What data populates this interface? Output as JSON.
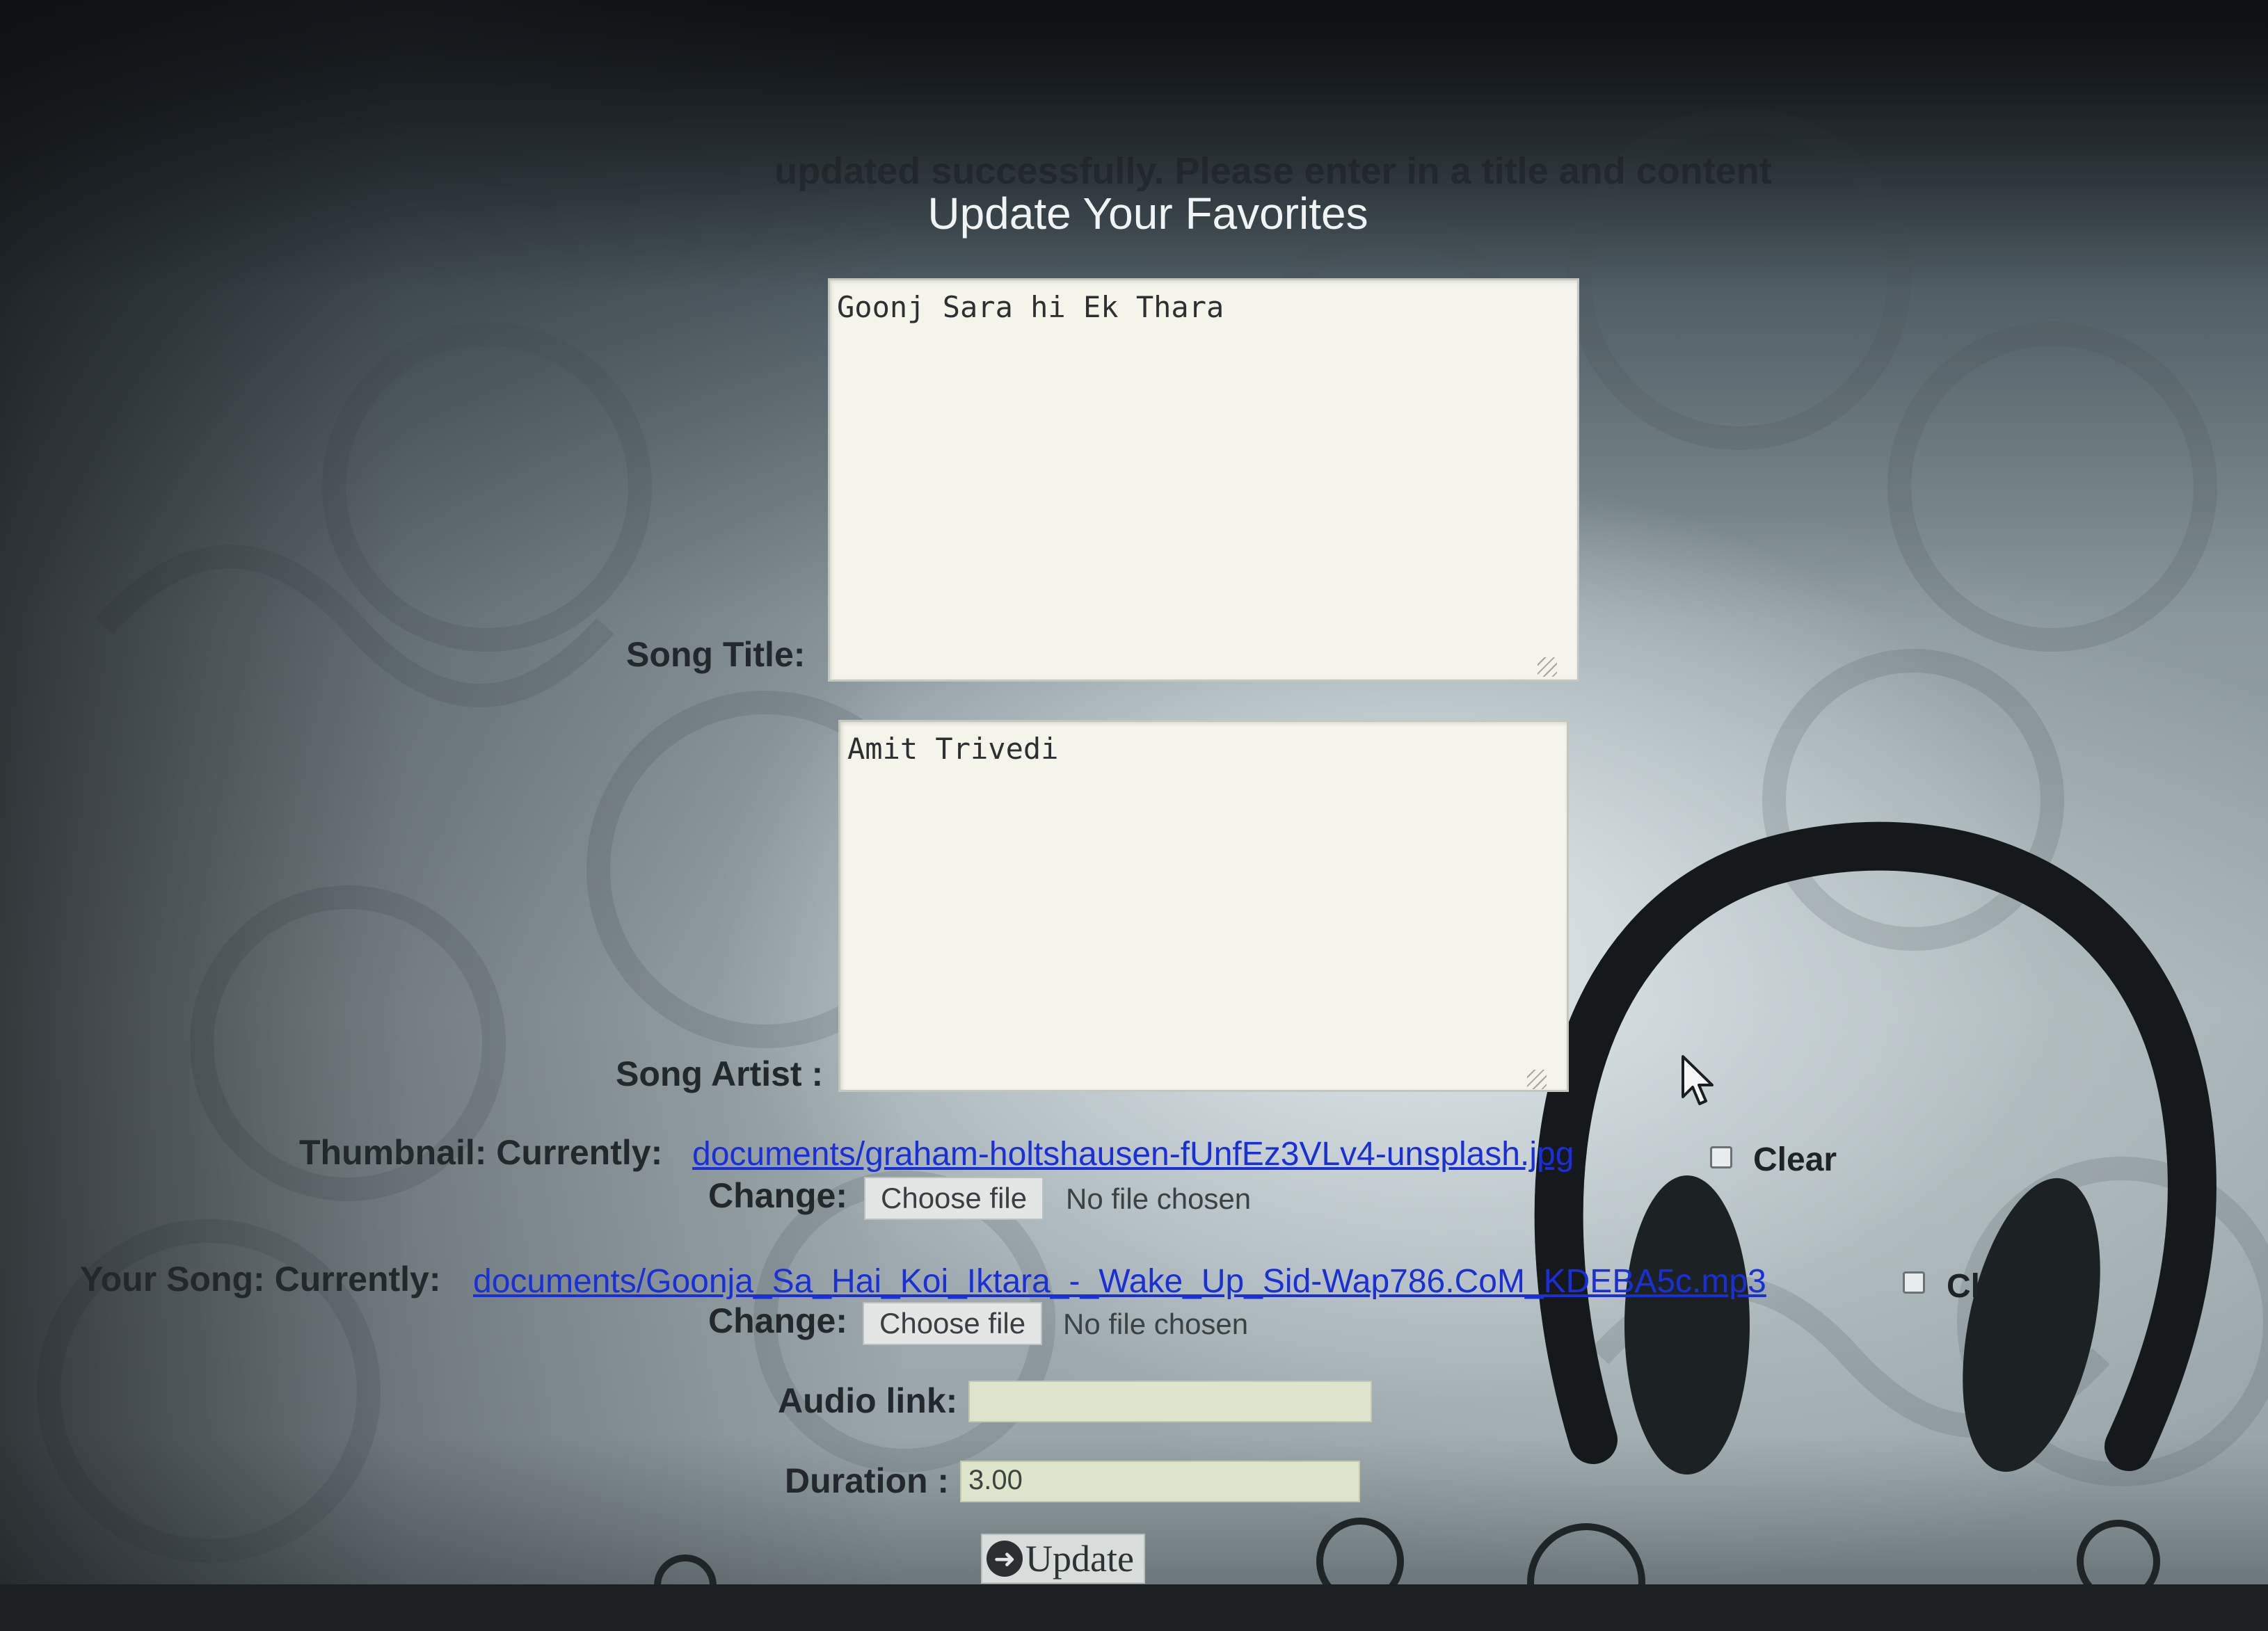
{
  "notice": "updated successfully. Please enter in a title and content",
  "page_title": "Update Your Favorites",
  "form": {
    "song_title": {
      "label": "Song Title:",
      "value": "Goonj Sara hi Ek Thara"
    },
    "song_artist": {
      "label": "Song Artist :",
      "value": "Amit Trivedi"
    },
    "thumbnail": {
      "label": "Thumbnail: Currently:",
      "current_file": "documents/graham-holtshausen-fUnfEz3VLv4-unsplash.jpg",
      "clear_label": "Clear",
      "change_label": "Change:",
      "choose_button": "Choose file",
      "file_status": "No file chosen"
    },
    "song_file": {
      "label": "Your Song: Currently:",
      "current_file": "documents/Goonja_Sa_Hai_Koi_Iktara_-_Wake_Up_Sid-Wap786.CoM_KDEBA5c.mp3",
      "clear_label": "Cl",
      "change_label": "Change:",
      "choose_button": "Choose file",
      "file_status": "No file chosen"
    },
    "audio_link": {
      "label": "Audio link:",
      "value": ""
    },
    "duration": {
      "label": "Duration :",
      "value": "3.00"
    },
    "submit_label": "Update"
  },
  "icons": {
    "update_icon": "circle-arrow-right-icon",
    "background_art": "headphones-icon",
    "pointer": "mouse-cursor-icon"
  },
  "colors": {
    "link": "#1b2fd6",
    "title_text": "#f1f4f4",
    "label_text": "#22282c"
  }
}
